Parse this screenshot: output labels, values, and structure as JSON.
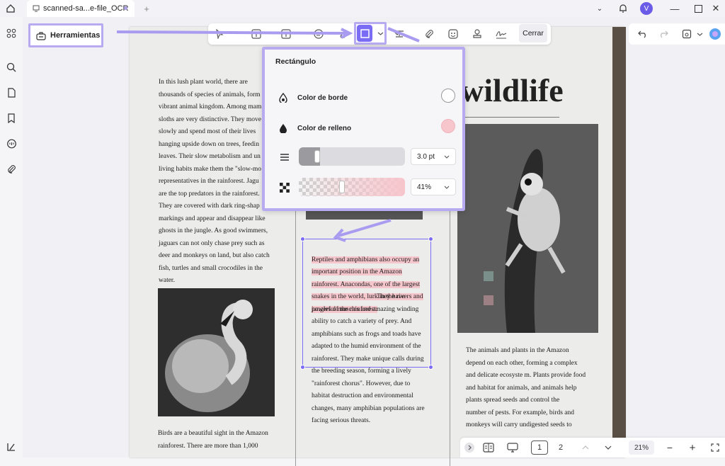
{
  "tab": {
    "title": "scanned-sa...e-file_OCR"
  },
  "avatar": {
    "initial": "V"
  },
  "toolbar": {
    "tools_label": "Herramientas",
    "close_label": "Cerrar"
  },
  "popup": {
    "title": "Rectángulo",
    "border_label": "Color de borde",
    "fill_label": "Color de relleno",
    "border_color": "#ffffff",
    "fill_color": "#f7c5cc",
    "thickness_value": "3.0 pt",
    "opacity_value": "41%",
    "thickness_level": 0.15,
    "opacity_level": 0.41
  },
  "document": {
    "headline": "wildlife",
    "col1_text": "In this lush plant world, there are\nthousands of species of animals, form\nvibrant animal kingdom. Among mam\nsloths are very distinctive. They move\nslowly and spend most of their lives\nhanging upside down on trees, feedin\nleaves. Their slow metabolism and un\nliving habits make them the \"slow-mo\nrepresentatives in the rainforest. Jagu\nare the top predators in the rainforest.\nThey are covered with dark ring-shap\nmarkings and appear and disappear like\nghosts in the jungle. As good swimmers,\njaguars can not only chase prey such as\ndeer and monkeys on land, but also catch\nfish, turtles and small crocodiles in the\nwater.",
    "col1_bottom": "Birds are a beautiful sight in the Amazon\nrainforest. There are more than 1,000",
    "col2_highlight": "Reptiles and amphibians also occupy an\nimportant position in the Amazon\nrainforest. Anacondas, one of the largest\nsnakes in the world, lurk in the rivers and\njungles of the rainforest.",
    "col2_rest": "They have\npowerful muscles and amazing winding\nability to catch a variety of prey. And\namphibians such as frogs and toads have\nadapted to the humid environment of the\nrainforest. They make unique calls during\nthe breeding season, forming a lively\n\"rainforest chorus\". However, due to\nhabitat destruction and environmental\nchanges, many amphibian populations are\nfacing serious threats.",
    "col3_text": "The animals and plants in the Amazon\ndepend on each other, forming a complex\nand delicate ecosyste m. Plants provide food\nand habitat for animals, and animals help\nplants spread seeds and control the\nnumber of pests. For example, birds and\nmonkeys will carry undigested seeds to"
  },
  "bottombar": {
    "page1": "1",
    "page2": "2",
    "zoom": "21%"
  },
  "colors": {
    "accent": "#7b6cf6",
    "annotation_frame": "#b7aaf0"
  }
}
